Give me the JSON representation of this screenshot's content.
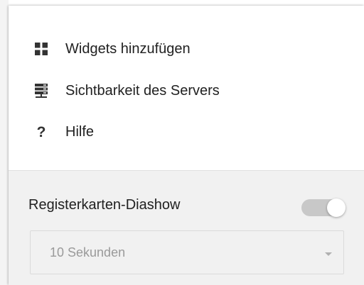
{
  "menu": {
    "items": [
      {
        "label": "Widgets hinzufügen",
        "icon": "grid-icon"
      },
      {
        "label": "Sichtbarkeit des Servers",
        "icon": "server-icon"
      },
      {
        "label": "Hilfe",
        "icon": "help-icon",
        "glyph": "?"
      }
    ]
  },
  "settings": {
    "slideshow": {
      "label": "Registerkarten-Diashow",
      "enabled": false
    },
    "interval": {
      "selected": "10 Sekunden"
    }
  },
  "colors": {
    "text": "#212121",
    "icon": "#333333",
    "settings_bg": "#f1f1f1",
    "toggle_track": "#c8c8c8",
    "muted_text": "#9a9a9a"
  }
}
